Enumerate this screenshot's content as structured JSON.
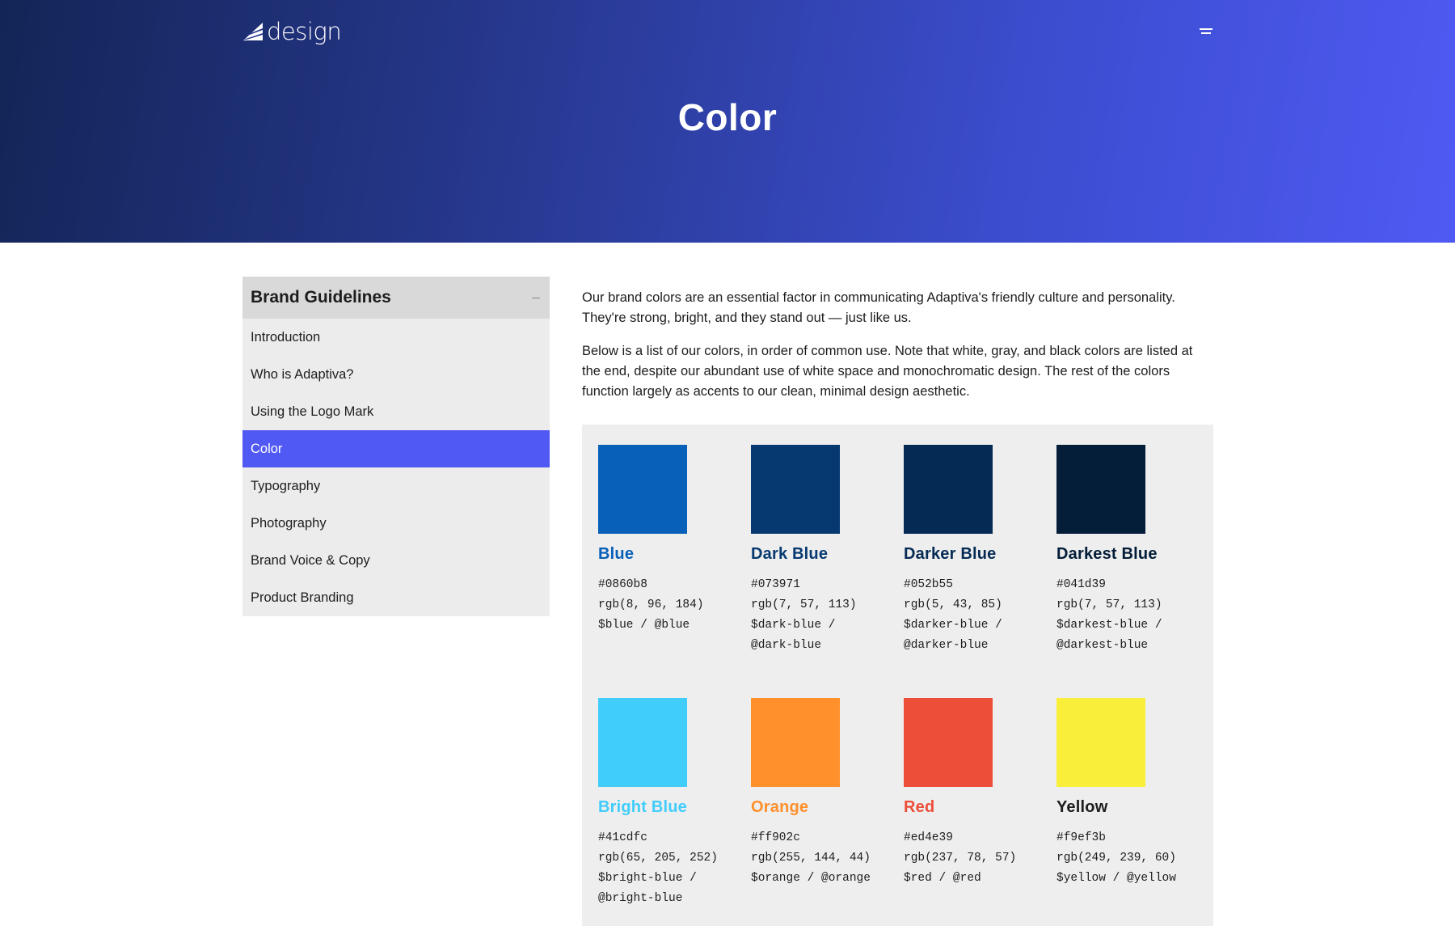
{
  "header": {
    "logo_text": "design",
    "title": "Color",
    "logo_icon": "adaptiva-sail-icon",
    "menu_icon": "hamburger-menu-icon"
  },
  "sidebar": {
    "title": "Brand Guidelines",
    "collapse_icon": "minus-icon",
    "items": [
      {
        "label": "Introduction",
        "active": false
      },
      {
        "label": "Who is Adaptiva?",
        "active": false
      },
      {
        "label": "Using the Logo Mark",
        "active": false
      },
      {
        "label": "Color",
        "active": true
      },
      {
        "label": "Typography",
        "active": false
      },
      {
        "label": "Photography",
        "active": false
      },
      {
        "label": "Brand Voice & Copy",
        "active": false
      },
      {
        "label": "Product Branding",
        "active": false
      }
    ]
  },
  "main": {
    "paragraphs": [
      "Our brand colors are an essential factor in communicating Adaptiva's friendly culture and personality. They're strong, bright, and they stand out — just like us.",
      "Below is a list of our colors, in order of common use. Note that white, gray, and black colors are listed at the end, despite our abundant use of white space and monochromatic design. The rest of the colors function largely as accents to our clean, minimal design aesthetic."
    ],
    "swatches": [
      {
        "name": "Blue",
        "hex": "#0860b8",
        "rgb": "rgb(8, 96, 184)",
        "var_line1": "$blue / @blue",
        "var_line2": "",
        "color": "#0860b8"
      },
      {
        "name": "Dark Blue",
        "hex": "#073971",
        "rgb": "rgb(7, 57, 113)",
        "var_line1": "$dark-blue /",
        "var_line2": "@dark-blue",
        "color": "#073971"
      },
      {
        "name": "Darker Blue",
        "hex": "#052b55",
        "rgb": "rgb(5, 43, 85)",
        "var_line1": "$darker-blue /",
        "var_line2": "@darker-blue",
        "color": "#052b55"
      },
      {
        "name": "Darkest Blue",
        "hex": "#041d39",
        "rgb": "rgb(7, 57, 113)",
        "var_line1": "$darkest-blue /",
        "var_line2": "@darkest-blue",
        "color": "#041d39"
      },
      {
        "name": "Bright Blue",
        "hex": "#41cdfc",
        "rgb": "rgb(65, 205, 252)",
        "var_line1": "$bright-blue /",
        "var_line2": "@bright-blue",
        "color": "#41cdfc"
      },
      {
        "name": "Orange",
        "hex": "#ff902c",
        "rgb": "rgb(255, 144, 44)",
        "var_line1": "$orange / @orange",
        "var_line2": "",
        "color": "#ff902c"
      },
      {
        "name": "Red",
        "hex": "#ed4e39",
        "rgb": "rgb(237, 78, 57)",
        "var_line1": "$red / @red",
        "var_line2": "",
        "color": "#ed4e39"
      },
      {
        "name": "Yellow",
        "hex": "#f9ef3b",
        "rgb": "rgb(249, 239, 60)",
        "var_line1": "$yellow / @yellow",
        "var_line2": "",
        "color": "#f9ef3b",
        "name_color": "#1d1d1f"
      }
    ]
  },
  "colors": {
    "accent": "#5059f3",
    "sidebar_bg": "#ececec",
    "sidebar_header_bg": "#d9d9d9",
    "panel_bg": "#eeeeee"
  }
}
